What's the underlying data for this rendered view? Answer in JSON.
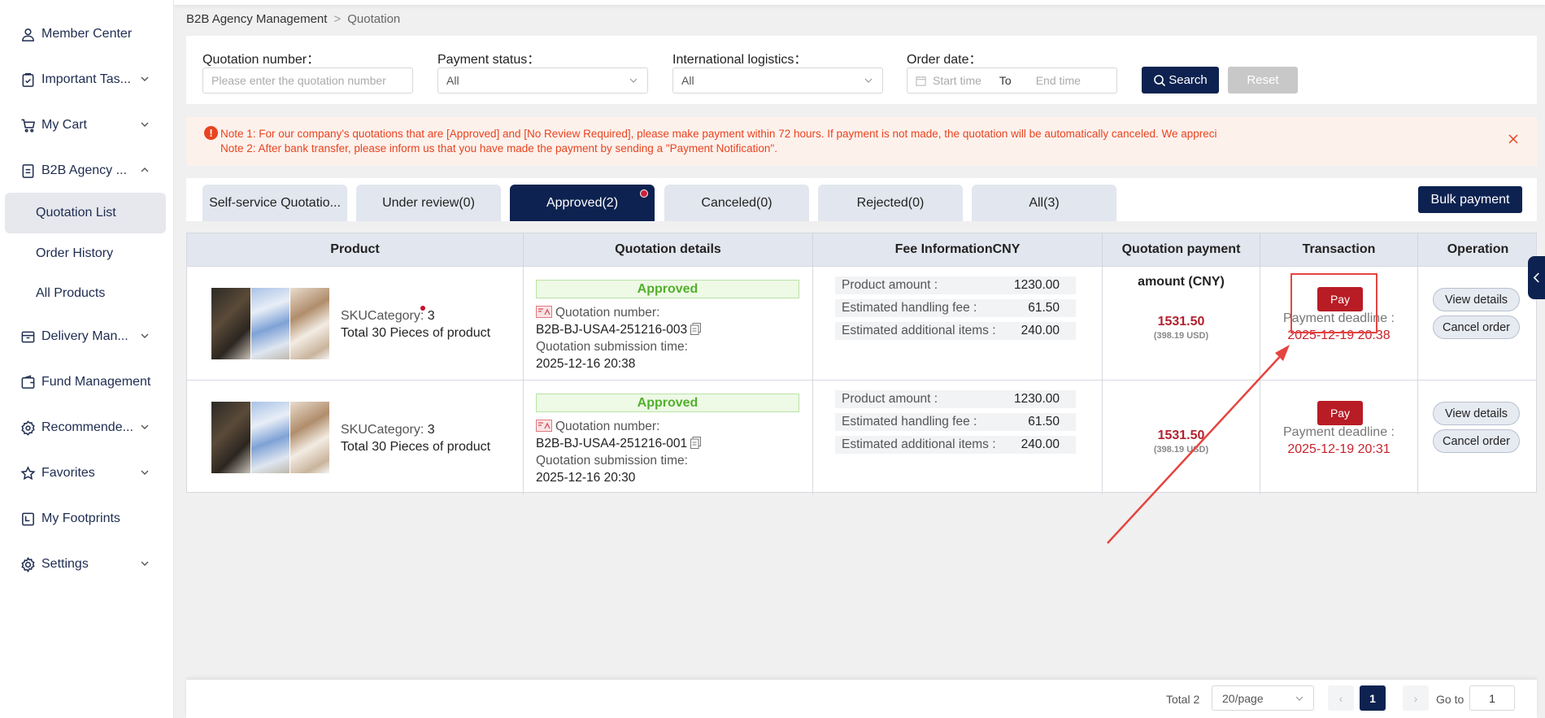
{
  "sidebar": {
    "items": [
      {
        "label": "Member Center",
        "icon": "user-icon"
      },
      {
        "label": "Important Tas...",
        "icon": "clipboard-icon"
      },
      {
        "label": "My Cart",
        "icon": "cart-icon"
      },
      {
        "label": "B2B Agency ...",
        "icon": "document-icon"
      },
      {
        "label": "Delivery Man...",
        "icon": "box-icon"
      },
      {
        "label": "Fund Management",
        "icon": "wallet-icon"
      },
      {
        "label": "Recommende...",
        "icon": "badge-icon"
      },
      {
        "label": "Favorites",
        "icon": "star-icon"
      },
      {
        "label": "My Footprints",
        "icon": "footprint-icon"
      },
      {
        "label": "Settings",
        "icon": "gear-icon"
      }
    ],
    "sub_items": [
      {
        "label": "Quotation List"
      },
      {
        "label": "Order History"
      },
      {
        "label": "All Products"
      }
    ]
  },
  "breadcrumb": {
    "root": "B2B Agency Management",
    "current": "Quotation"
  },
  "filters": {
    "quotation_number_label": "Quotation number：",
    "quotation_number_placeholder": "Please enter the quotation number",
    "payment_status_label": "Payment status：",
    "payment_status_value": "All",
    "logistics_label": "International logistics：",
    "logistics_value": "All",
    "order_date_label": "Order date：",
    "start_placeholder": "Start time",
    "to_label": "To",
    "end_placeholder": "End time",
    "search_label": "Search",
    "reset_label": "Reset"
  },
  "notice": {
    "line1": "Note 1: For our company's quotations that are [Approved] and [No Review Required], please make payment within 72 hours. If payment is not made, the quotation will be automatically canceled. We appreci",
    "line2": "Note 2: After bank transfer, please inform us that you have made the payment by sending a \"Payment Notification\"."
  },
  "tabs": [
    {
      "label": "Self-service Quotatio..."
    },
    {
      "label": "Under review(0)"
    },
    {
      "label": "Approved(2)"
    },
    {
      "label": "Canceled(0)"
    },
    {
      "label": "Rejected(0)"
    },
    {
      "label": "All(3)"
    }
  ],
  "bulk_payment_label": "Bulk payment",
  "table": {
    "headers": [
      "Product",
      "Quotation details",
      "Fee InformationCNY",
      "Quotation payment",
      "Transaction",
      "Operation"
    ],
    "amount_label": "amount (CNY)",
    "rows": [
      {
        "sku_label": "SKUCategory: ",
        "sku_count": "3",
        "pieces": "Total 30 Pieces of product",
        "status": "Approved",
        "qnum_label": "Quotation number:",
        "qnum": "B2B-BJ-USA4-251216-003",
        "submit_label": "Quotation submission time:",
        "submit_time": "2025-12-16 20:38",
        "fees": [
          {
            "label": "Product amount :",
            "value": "1230.00"
          },
          {
            "label": "Estimated handling fee :",
            "value": "61.50"
          },
          {
            "label": "Estimated additional items :",
            "value": "240.00"
          }
        ],
        "amount": "1531.50",
        "usd": "(398.19 USD)",
        "pay_label": "Pay",
        "deadline_label": "Payment deadline :",
        "deadline": "2025-12-19 20:38",
        "view_label": "View details",
        "cancel_label": "Cancel order"
      },
      {
        "sku_label": "SKUCategory: ",
        "sku_count": "3",
        "pieces": "Total 30 Pieces of product",
        "status": "Approved",
        "qnum_label": "Quotation number:",
        "qnum": "B2B-BJ-USA4-251216-001",
        "submit_label": "Quotation submission time:",
        "submit_time": "2025-12-16 20:30",
        "fees": [
          {
            "label": "Product amount :",
            "value": "1230.00"
          },
          {
            "label": "Estimated handling fee :",
            "value": "61.50"
          },
          {
            "label": "Estimated additional items :",
            "value": "240.00"
          }
        ],
        "amount": "1531.50",
        "usd": "(398.19 USD)",
        "pay_label": "Pay",
        "deadline_label": "Payment deadline :",
        "deadline": "2025-12-19 20:31",
        "view_label": "View details",
        "cancel_label": "Cancel order"
      }
    ]
  },
  "pagination": {
    "total": "Total 2",
    "page_size": "20/page",
    "current_page": "1",
    "goto_label": "Go to",
    "goto_value": "1"
  },
  "colors": {
    "primary": "#0d2250",
    "pay": "#b81c25",
    "approved": "#52b02c",
    "notice": "#e8441f",
    "annotation": "#e54540"
  }
}
